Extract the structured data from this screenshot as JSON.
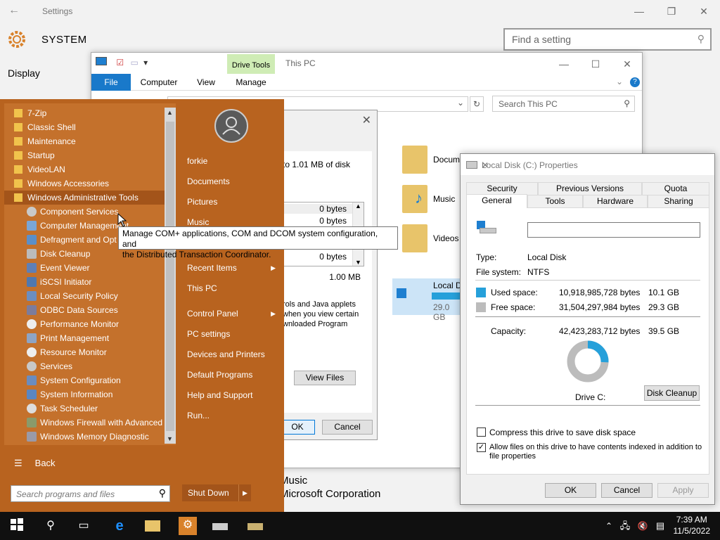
{
  "settings": {
    "title": "Settings",
    "header": "SYSTEM",
    "find_placeholder": "Find a setting",
    "nav_display": "Display",
    "bg_music": "Music",
    "bg_ms": "Microsoft Corporation"
  },
  "explorer": {
    "drive_tools": "Drive Tools",
    "title": "This PC",
    "tabs": [
      "File",
      "Computer",
      "View",
      "Manage"
    ],
    "search_placeholder": "Search This PC",
    "folders": [
      "Docum",
      "Music",
      "Videos"
    ],
    "drive_name": "Local D",
    "drive_free": "29.0 GB"
  },
  "cleanup": {
    "disk_text": "to 1.01 MB of disk",
    "list_sizes": [
      "0 bytes",
      "0 bytes",
      "0 bytes"
    ],
    "total": "1.00 MB",
    "desc": [
      "rols and Java applets",
      "when you view certain",
      "wnloaded Program"
    ],
    "view_files": "View Files",
    "ok": "OK",
    "cancel": "Cancel"
  },
  "properties": {
    "title": "Local Disk (C:) Properties",
    "tabs_row1": [
      "Security",
      "Previous Versions",
      "Quota"
    ],
    "tabs_row2": [
      "General",
      "Tools",
      "Hardware",
      "Sharing"
    ],
    "type_label": "Type:",
    "type_value": "Local Disk",
    "fs_label": "File system:",
    "fs_value": "NTFS",
    "used_label": "Used space:",
    "used_bytes": "10,918,985,728 bytes",
    "used_gb": "10.1 GB",
    "free_label": "Free space:",
    "free_bytes": "31,504,297,984 bytes",
    "free_gb": "29.3 GB",
    "cap_label": "Capacity:",
    "cap_bytes": "42,423,283,712 bytes",
    "cap_gb": "39.5 GB",
    "drive_label": "Drive C:",
    "disk_cleanup": "Disk Cleanup",
    "compress": "Compress this drive to save disk space",
    "index_line1": "Allow files on this drive to have contents indexed in addition to",
    "index_line2": "file properties",
    "ok": "OK",
    "cancel": "Cancel",
    "apply": "Apply",
    "used_color": "#26a0da",
    "free_color": "#bcbcbc"
  },
  "start": {
    "folders": [
      "7-Zip",
      "Classic Shell",
      "Maintenance",
      "Startup",
      "VideoLAN",
      "Windows Accessories",
      "Windows Administrative Tools"
    ],
    "tools": [
      "Component Services",
      "Computer Management",
      "Defragment and Opt",
      "Disk Cleanup",
      "Event Viewer",
      "iSCSI Initiator",
      "Local Security Policy",
      "ODBC Data Sources",
      "Performance Monitor",
      "Print Management",
      "Resource Monitor",
      "Services",
      "System Configuration",
      "System Information",
      "Task Scheduler",
      "Windows Firewall with Advanced",
      "Windows Memory Diagnostic"
    ],
    "back": "Back",
    "search_placeholder": "Search programs and files",
    "user": "forkie",
    "right_items": [
      "Documents",
      "Pictures",
      "Music",
      "Recent Items",
      "This PC",
      "Control Panel",
      "PC settings",
      "Devices and Printers",
      "Default Programs",
      "Help and Support",
      "Run..."
    ],
    "shutdown": "Shut Down"
  },
  "tooltip": {
    "line1": "Manage COM+ applications, COM and DCOM system configuration, and",
    "line2": "the Distributed Transaction Coordinator."
  },
  "taskbar": {
    "time": "7:39 AM",
    "date": "11/5/2022"
  }
}
